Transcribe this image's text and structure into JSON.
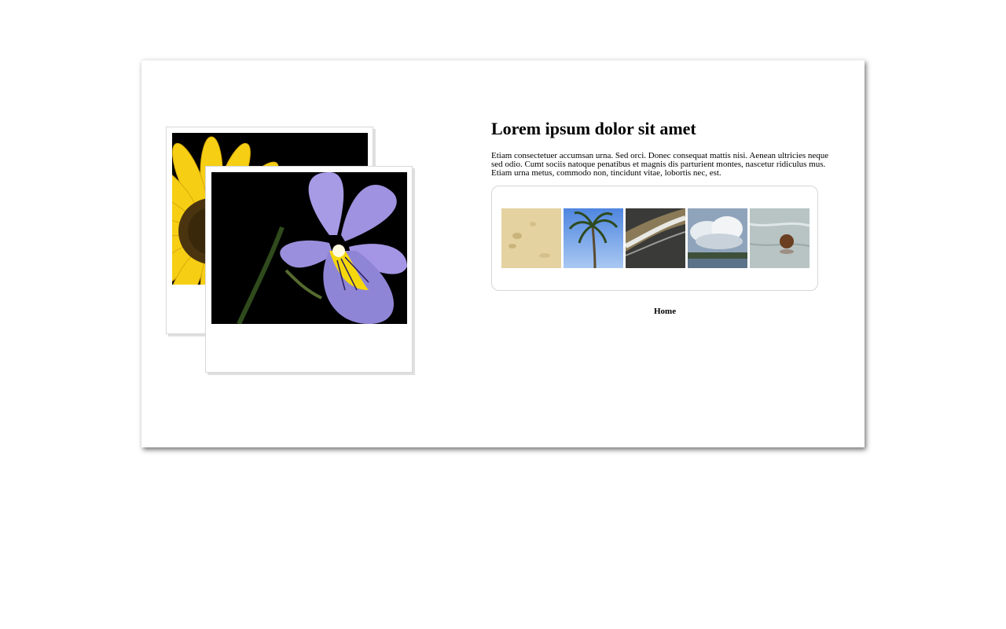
{
  "content": {
    "title": "Lorem ipsum dolor sit amet",
    "description": "Etiam consectetuer accumsan urna. Sed orci. Donec consequat mattis nisi. Aenean ultricies neque sed odio. Cumt sociis natoque penatibus et magnis dis parturient montes, nascetur ridiculus mus. Etiam urna metus, commodo non, tincidunt vitae, lobortis nec, est."
  },
  "polaroids": [
    {
      "icon": "sunflower-photo"
    },
    {
      "icon": "violet-pansy-photo"
    }
  ],
  "gallery": {
    "thumbnails": [
      {
        "icon": "sand-footprints-thumbnail"
      },
      {
        "icon": "palm-tree-thumbnail"
      },
      {
        "icon": "ocean-wave-thumbnail"
      },
      {
        "icon": "cloudy-sky-thumbnail"
      },
      {
        "icon": "coconut-beach-thumbnail"
      }
    ]
  },
  "nav": {
    "home_label": "Home"
  },
  "colors": {
    "background": "#ffffff",
    "text": "#000000",
    "border": "#d6d6d6"
  }
}
